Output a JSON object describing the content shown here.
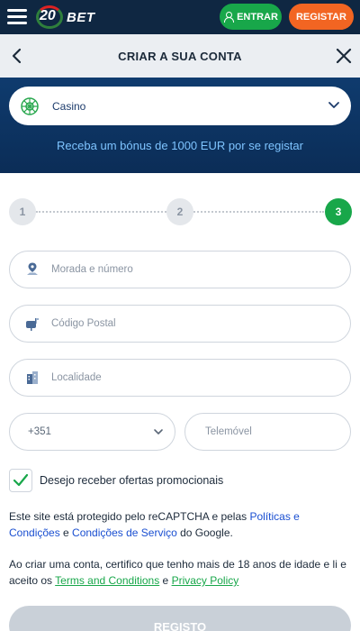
{
  "topbar": {
    "logo_number": "20",
    "logo_text": "BET",
    "login_label": "ENTRAR",
    "register_label": "REGISTAR"
  },
  "header": {
    "title": "CRIAR A SUA CONTA"
  },
  "banner": {
    "product_select": "Casino",
    "bonus_text": "Receba um bónus de 1000 EUR por se registar"
  },
  "steps": [
    {
      "number": "1",
      "state": "done"
    },
    {
      "number": "2",
      "state": "done"
    },
    {
      "number": "3",
      "state": "current"
    }
  ],
  "form": {
    "address_placeholder": "Morada e número",
    "postal_code_placeholder": "Código Postal",
    "city_placeholder": "Localidade",
    "phone_code": "+351",
    "phone_placeholder": "Telemóvel",
    "promo_checkbox_label": "Desejo receber ofertas promocionais",
    "promo_checked": true
  },
  "legal": {
    "recaptcha_prefix": "Este site está protegido pelo reCAPTCHA e pelas ",
    "policies_link": "Políticas e Condições",
    "recaptcha_and": " e ",
    "terms_service_link": "Condições de Serviço",
    "recaptcha_suffix": " do Google.",
    "age_prefix": "Ao criar uma conta, certifico que tenho mais de 18 anos de idade e li e aceito os ",
    "terms_link": "Terms and Conditions",
    "age_and": " e ",
    "privacy_link": "Privacy Policy"
  },
  "submit_label": "REGISTO",
  "colors": {
    "navy": "#0f2742",
    "green": "#18a74a",
    "orange": "#f26522",
    "link_blue": "#1a4fd1"
  }
}
